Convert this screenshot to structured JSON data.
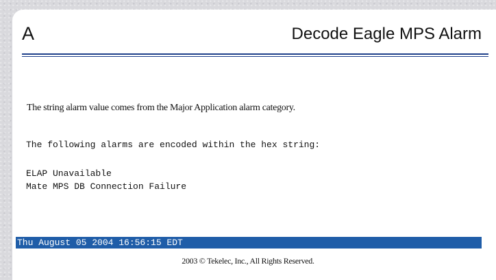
{
  "header": {
    "letter": "A",
    "title": "Decode Eagle MPS Alarm"
  },
  "content": {
    "description": "The string alarm value comes from the Major Application alarm category.",
    "encoded_intro": "The following alarms are encoded within the hex string:",
    "alarms": [
      "ELAP Unavailable",
      "Mate MPS DB Connection Failure"
    ]
  },
  "status_bar": {
    "timestamp": "Thu August 05 2004 16:56:15 EDT"
  },
  "footer": {
    "copyright": "2003 © Tekelec, Inc., All Rights Reserved."
  },
  "colors": {
    "accent_rule": "#1e3f8a",
    "status_bar_bg": "#1f5da8",
    "status_bar_text": "#ffffff",
    "page_bg": "#d9d9dd"
  }
}
